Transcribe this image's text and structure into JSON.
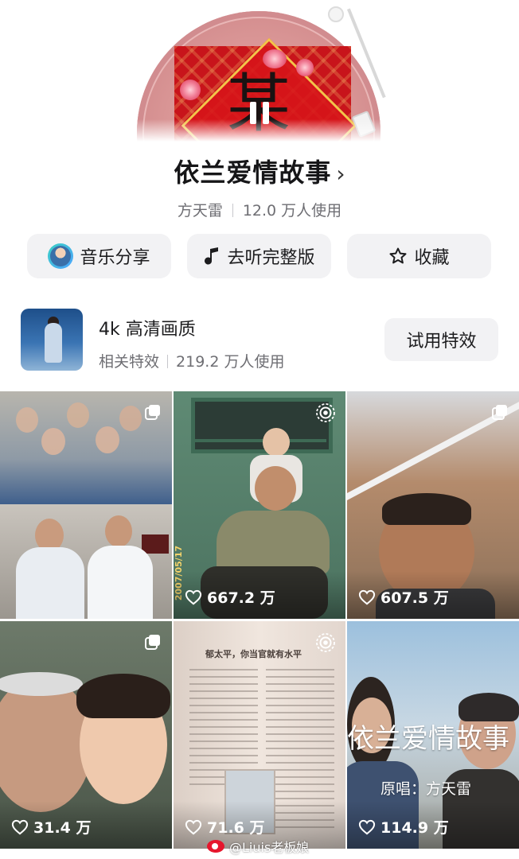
{
  "player": {
    "album_glyph": "某",
    "state": "playing"
  },
  "song": {
    "title": "依兰爱情故事",
    "artist": "方天雷",
    "usage": "12.0 万人使用"
  },
  "actions": {
    "share": "音乐分享",
    "listen_full": "去听完整版",
    "favorite": "收藏"
  },
  "effect": {
    "title": "4k 高清画质",
    "category": "相关特效",
    "usage": "219.2 万人使用",
    "try_button": "试用特效"
  },
  "videos": [
    {
      "likes": "",
      "corner_icon": "multi-image-icon"
    },
    {
      "likes": "667.2 万",
      "corner_icon": "live-icon",
      "date_stamp": "2007/05/17"
    },
    {
      "likes": "607.5 万",
      "corner_icon": "multi-image-icon"
    },
    {
      "likes": "31.4 万",
      "corner_icon": "multi-image-icon"
    },
    {
      "likes": "71.6 万",
      "corner_icon": "live-icon",
      "book_heading": "郁太平，你当官就有水平"
    },
    {
      "likes": "114.9 万",
      "corner_icon": "",
      "overlay_title": "依兰爱情故事",
      "overlay_subtitle": "原唱：方天雷"
    }
  ],
  "watermark": "@Liuis老板娘",
  "colors": {
    "disc": "#d99595",
    "album_red": "#c8141b",
    "button_bg": "#f2f2f4",
    "meta_gray": "#6e6e73"
  }
}
